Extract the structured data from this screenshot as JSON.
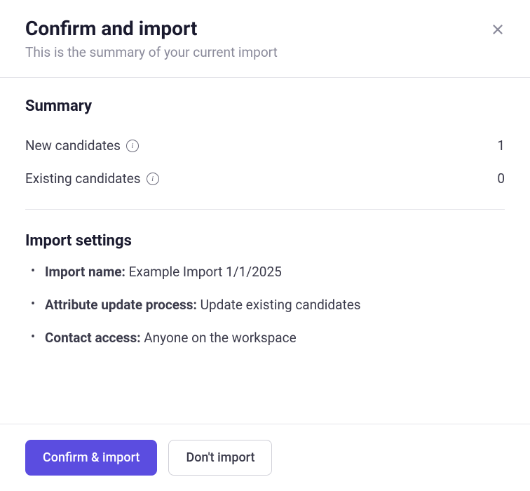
{
  "header": {
    "title": "Confirm and import",
    "subtitle": "This is the summary of your current import"
  },
  "summary": {
    "heading": "Summary",
    "rows": [
      {
        "label": "New candidates",
        "value": "1"
      },
      {
        "label": "Existing candidates",
        "value": "0"
      }
    ]
  },
  "import_settings": {
    "heading": "Import settings",
    "items": [
      {
        "key": "Import name:",
        "value": "Example Import 1/1/2025"
      },
      {
        "key": "Attribute update process:",
        "value": "Update existing candidates"
      },
      {
        "key": "Contact access:",
        "value": "Anyone on the workspace"
      }
    ]
  },
  "footer": {
    "confirm_label": "Confirm & import",
    "cancel_label": "Don't import"
  }
}
